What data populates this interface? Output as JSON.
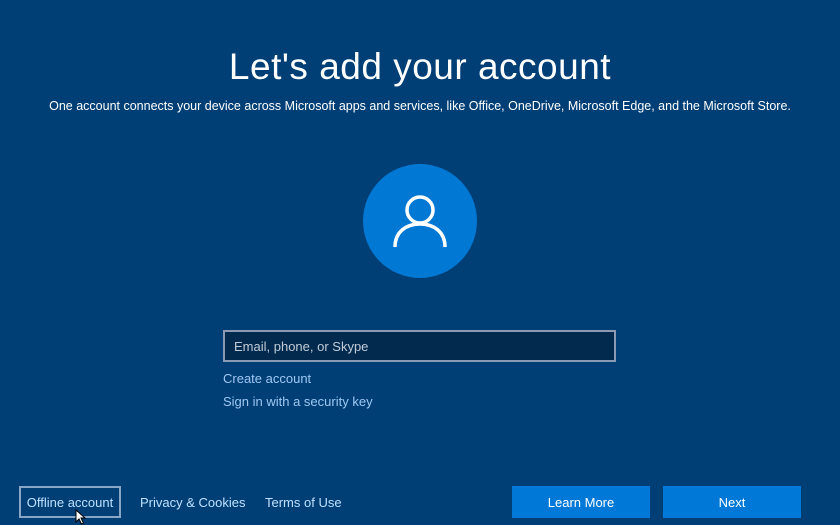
{
  "header": {
    "title": "Let's add your account",
    "subtitle": "One account connects your device across Microsoft apps and services, like Office, OneDrive, Microsoft Edge, and the Microsoft Store."
  },
  "avatar": {
    "icon": "user-icon"
  },
  "signin": {
    "email_placeholder": "Email, phone, or Skype",
    "create_account": "Create account",
    "security_key": "Sign in with a security key"
  },
  "footer": {
    "offline_account": "Offline account",
    "privacy": "Privacy & Cookies",
    "terms": "Terms of Use",
    "learn_more": "Learn More",
    "next": "Next"
  },
  "colors": {
    "background": "#003f76",
    "accent": "#0078d7",
    "link": "#9ec8f2"
  }
}
